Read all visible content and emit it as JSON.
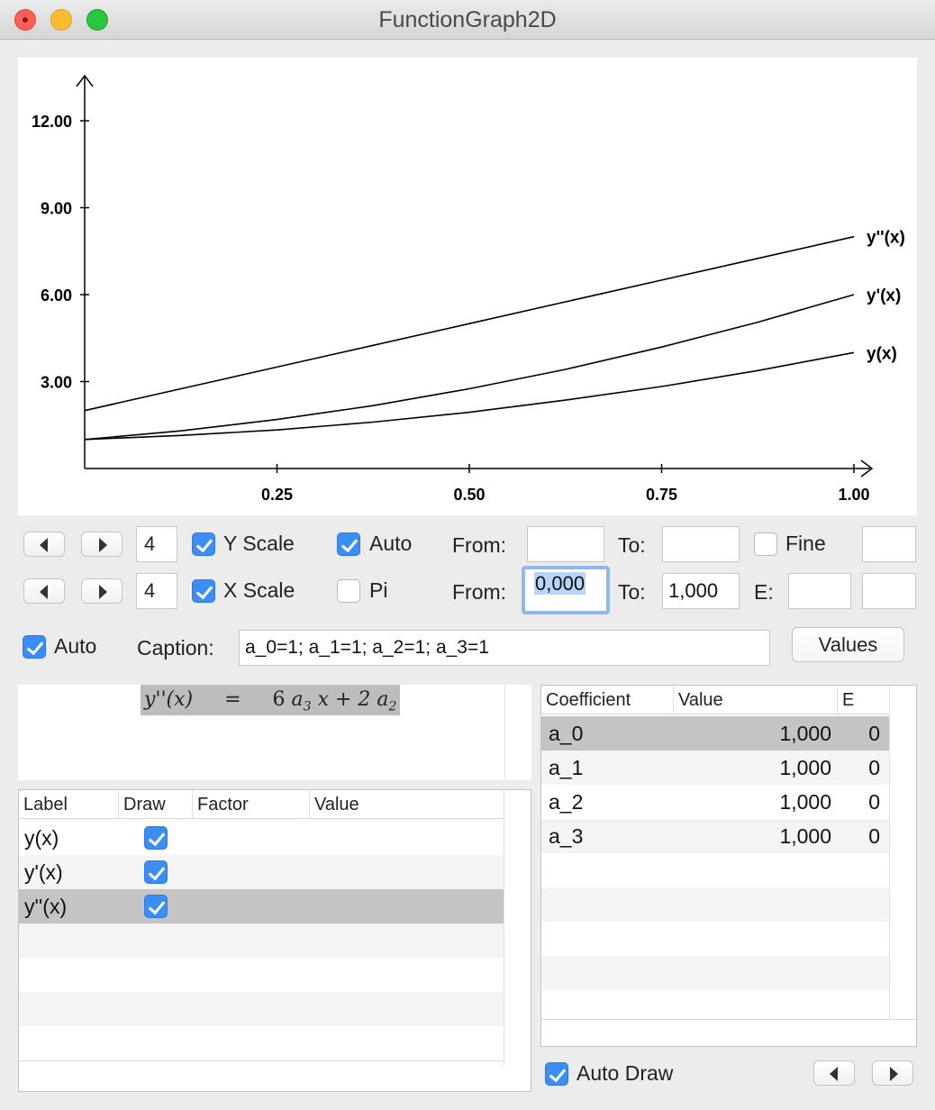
{
  "window": {
    "title": "FunctionGraph2D"
  },
  "chart_data": {
    "type": "line",
    "title": "",
    "xlabel": "",
    "ylabel": "",
    "xlim": [
      0,
      1.0
    ],
    "ylim": [
      0,
      13.5
    ],
    "x_ticks": [
      "0.25",
      "0.50",
      "0.75",
      "1.00"
    ],
    "y_ticks": [
      "3.00",
      "6.00",
      "9.00",
      "12.00"
    ],
    "x": [
      0,
      0.125,
      0.25,
      0.375,
      0.5,
      0.625,
      0.75,
      0.875,
      1.0
    ],
    "series": [
      {
        "name": "y(x)",
        "values": [
          1.0,
          1.14,
          1.33,
          1.6,
          1.94,
          2.36,
          2.83,
          3.38,
          4.0
        ]
      },
      {
        "name": "y'(x)",
        "values": [
          1.0,
          1.3,
          1.69,
          2.17,
          2.75,
          3.42,
          4.19,
          5.05,
          6.0
        ]
      },
      {
        "name": "y''(x)",
        "values": [
          2.0,
          2.75,
          3.5,
          4.25,
          5.0,
          5.75,
          6.5,
          7.25,
          8.0
        ]
      }
    ],
    "grid": false,
    "legend": "labels at line ends"
  },
  "controls": {
    "y_row": {
      "steps": "4",
      "scale_label": "Y Scale",
      "scale_checked": true,
      "auto_label": "Auto",
      "auto_checked": true,
      "from_label": "From:",
      "from_value": "",
      "to_label": "To:",
      "to_value": "",
      "fine_label": "Fine",
      "fine_checked": false,
      "extra_value": ""
    },
    "x_row": {
      "steps": "4",
      "scale_label": "X Scale",
      "scale_checked": true,
      "pi_label": "Pi",
      "pi_checked": false,
      "from_label": "From:",
      "from_value": "0,000",
      "to_label": "To:",
      "to_value": "1,000",
      "e_label": "E:",
      "e_value": "",
      "extra_value": ""
    },
    "caption_row": {
      "auto_label": "Auto",
      "auto_checked": true,
      "caption_label": "Caption:",
      "caption_value": "a_0=1; a_1=1; a_2=1; a_3=1",
      "values_button": "Values"
    }
  },
  "formula": {
    "lhs": "y''(x)",
    "eq": "=",
    "rhs_a": "6",
    "a3": "a",
    "a3_sub": "3",
    "rhs_b": "x + 2",
    "a2": "a",
    "a2_sub": "2"
  },
  "functions_table": {
    "headers": [
      "Label",
      "Draw",
      "Factor",
      "Value"
    ],
    "rows": [
      {
        "label": "y(x)",
        "draw": true,
        "factor": "",
        "value": ""
      },
      {
        "label": "y'(x)",
        "draw": true,
        "factor": "",
        "value": ""
      },
      {
        "label": "y''(x)",
        "draw": true,
        "factor": "",
        "value": ""
      }
    ]
  },
  "coeff_table": {
    "headers": [
      "Coefficient",
      "Value",
      "E"
    ],
    "rows": [
      {
        "name": "a_0",
        "value": "1,000",
        "e": "0"
      },
      {
        "name": "a_1",
        "value": "1,000",
        "e": "0"
      },
      {
        "name": "a_2",
        "value": "1,000",
        "e": "0"
      },
      {
        "name": "a_3",
        "value": "1,000",
        "e": "0"
      }
    ]
  },
  "footer": {
    "auto_draw_label": "Auto Draw",
    "auto_draw_checked": true
  }
}
